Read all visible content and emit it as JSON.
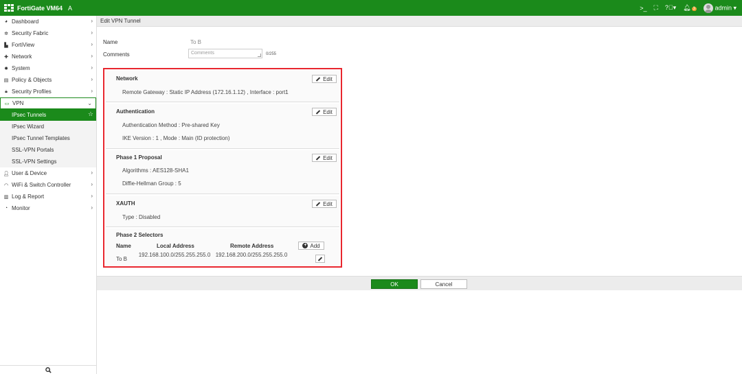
{
  "topbar": {
    "brand": "FortiGate VM64",
    "brand_suffix": "A",
    "cli_icon": "terminal-icon",
    "fullscreen_icon": "fullscreen-icon",
    "help_label": "?",
    "notif_count": "3",
    "user": "admin",
    "accent": "#1b8a1b"
  },
  "sidebar": {
    "items": [
      {
        "label": "Dashboard",
        "icon": "dashboard-icon"
      },
      {
        "label": "Security Fabric",
        "icon": "fabric-icon"
      },
      {
        "label": "FortiView",
        "icon": "fortiview-icon"
      },
      {
        "label": "Network",
        "icon": "network-icon"
      },
      {
        "label": "System",
        "icon": "system-icon"
      },
      {
        "label": "Policy & Objects",
        "icon": "policy-icon"
      },
      {
        "label": "Security Profiles",
        "icon": "lock-icon"
      },
      {
        "label": "VPN",
        "icon": "vpn-icon"
      }
    ],
    "vpn_sub": [
      {
        "label": "IPsec Tunnels"
      },
      {
        "label": "IPsec Wizard"
      },
      {
        "label": "IPsec Tunnel Templates"
      },
      {
        "label": "SSL-VPN Portals"
      },
      {
        "label": "SSL-VPN Settings"
      }
    ],
    "items_after": [
      {
        "label": "User & Device",
        "icon": "user-icon"
      },
      {
        "label": "WiFi & Switch Controller",
        "icon": "wifi-icon"
      },
      {
        "label": "Log & Report",
        "icon": "chart-icon"
      },
      {
        "label": "Monitor",
        "icon": "monitor-icon"
      }
    ]
  },
  "page": {
    "title": "Edit VPN Tunnel",
    "name_label": "Name",
    "name_value": "To B",
    "comments_label": "Comments",
    "comments_placeholder": "Comments",
    "comments_count": "0/255"
  },
  "sections": {
    "network": {
      "title": "Network",
      "edit": "Edit",
      "line1": "Remote Gateway : Static IP Address (172.16.1.12) , Interface : port1"
    },
    "auth": {
      "title": "Authentication",
      "edit": "Edit",
      "line1": "Authentication Method : Pre-shared Key",
      "line2": "IKE Version : 1 , Mode : Main (ID protection)"
    },
    "phase1": {
      "title": "Phase 1 Proposal",
      "edit": "Edit",
      "line1": "Algorithms : AES128-SHA1",
      "line2": "Diffie-Hellman Group : 5"
    },
    "xauth": {
      "title": "XAUTH",
      "edit": "Edit",
      "line1": "Type : Disabled"
    },
    "phase2": {
      "title": "Phase 2 Selectors",
      "col_name": "Name",
      "col_local": "Local Address",
      "col_remote": "Remote Address",
      "add": "Add",
      "rows": [
        {
          "name": "To B",
          "local": "192.168.100.0/255.255.255.0",
          "remote": "192.168.200.0/255.255.255.0"
        }
      ]
    }
  },
  "footer": {
    "ok": "OK",
    "cancel": "Cancel"
  }
}
